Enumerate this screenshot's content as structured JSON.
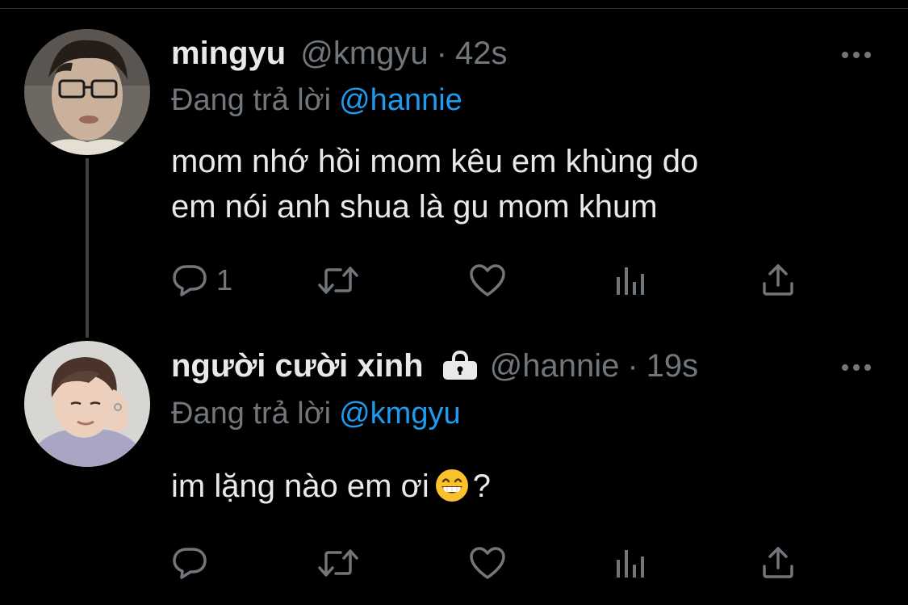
{
  "tweets": [
    {
      "display_name": "mingyu",
      "handle": "@kmgyu",
      "separator": "·",
      "time": "42s",
      "protected": false,
      "reply_label": "Đang trả lời",
      "reply_to": "@hannie",
      "text_lines": [
        "mom nhớ hồi mom kêu em khùng do",
        "em nói anh shua là gu mom khum"
      ],
      "reply_count": "1",
      "avatar_icon": "avatar-photo"
    },
    {
      "display_name": "người cười xinh",
      "handle": "@hannie",
      "separator": "·",
      "time": "19s",
      "protected": true,
      "lock_icon": "lock-icon",
      "reply_label": "Đang trả lời",
      "reply_to": "@kmgyu",
      "text_before_emoji": "im lặng nào em ơi",
      "emoji": "grinning-face-with-smiling-eyes",
      "text_after_emoji": "?",
      "reply_count": "",
      "avatar_icon": "avatar-photo"
    }
  ],
  "icons": {
    "reply": "reply-icon",
    "retweet": "retweet-icon",
    "like": "heart-icon",
    "views": "analytics-icon",
    "share": "share-icon",
    "more": "more-icon"
  },
  "colors": {
    "background": "#000000",
    "text": "#e7e9ea",
    "secondary": "#71767b",
    "link": "#1d9bf0",
    "thread_line": "#3e4144"
  }
}
